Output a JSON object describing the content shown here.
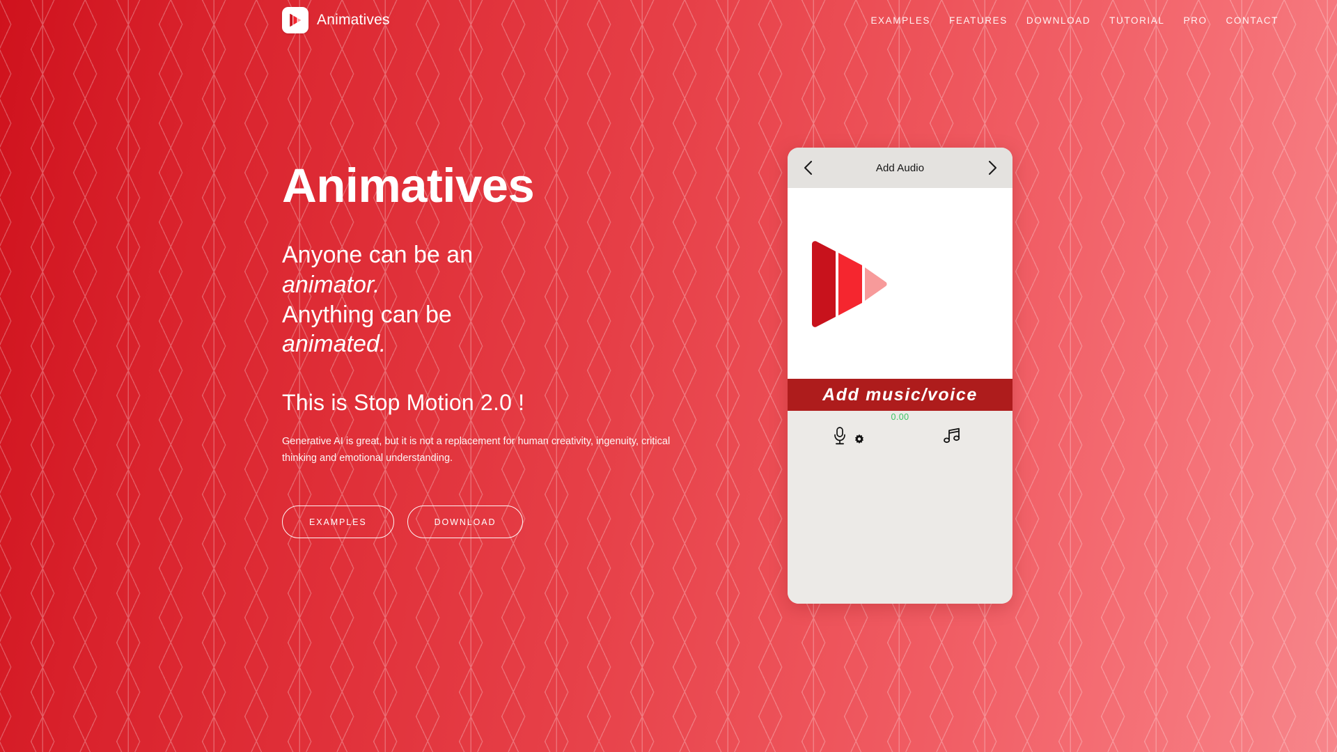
{
  "brand": {
    "name": "Animatives",
    "logo_icon": "play-triangle-icon"
  },
  "nav": {
    "items": [
      {
        "label": "EXAMPLES"
      },
      {
        "label": "FEATURES"
      },
      {
        "label": "DOWNLOAD"
      },
      {
        "label": "TUTORIAL"
      },
      {
        "label": "PRO"
      },
      {
        "label": "CONTACT"
      }
    ]
  },
  "hero": {
    "title": "Animatives",
    "sub_line1": "Anyone can be an",
    "sub_line2": "animator.",
    "sub_line3": "Anything can be",
    "sub_line4": "animated.",
    "tagline": "This is Stop Motion 2.0 !",
    "paragraph": "Generative AI is great, but it is not a replacement for human creativity, ingenuity, critical thinking and emotional understanding.",
    "cta_examples": "EXAMPLES",
    "cta_download": "DOWNLOAD"
  },
  "phone": {
    "header_title": "Add Audio",
    "back_icon": "chevron-left-icon",
    "forward_icon": "chevron-right-icon",
    "canvas_logo_icon": "play-triangle-icon",
    "banner_label": "Add music/voice",
    "timecode": "0.00",
    "tools": [
      {
        "icon": "microphone-icon"
      },
      {
        "icon": "gear-icon"
      },
      {
        "icon": "music-note-icon"
      }
    ]
  },
  "colors": {
    "brand_red": "#d91f28",
    "banner_red": "#ae1c1c",
    "timecode_green": "#3ac463",
    "card_grey": "#eceae7",
    "logo_dark": "#c8121c",
    "logo_mid": "#f5262f",
    "logo_light": "#f79a9a"
  }
}
